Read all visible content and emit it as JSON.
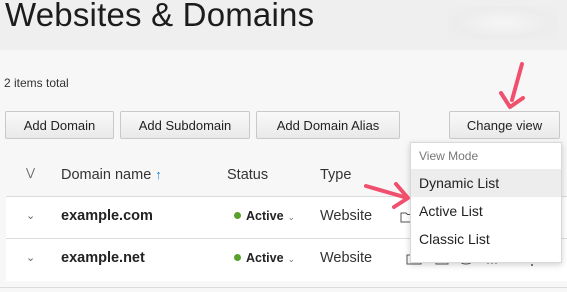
{
  "page": {
    "title": "Websites & Domains",
    "items_total": "2 items total"
  },
  "toolbar": {
    "add_domain": "Add Domain",
    "add_subdomain": "Add Subdomain",
    "add_domain_alias": "Add Domain Alias",
    "change_view": "Change view"
  },
  "table": {
    "columns": {
      "domain_name": "Domain name",
      "status": "Status",
      "type": "Type"
    },
    "sort_icon": "arrow-up-icon",
    "rows": [
      {
        "domain": "example.com",
        "status": "Active",
        "type": "Website"
      },
      {
        "domain": "example.net",
        "status": "Active",
        "type": "Website"
      }
    ]
  },
  "view_menu": {
    "header": "View Mode",
    "options": [
      "Dynamic List",
      "Active List",
      "Classic List"
    ],
    "highlighted": "Dynamic List"
  },
  "colors": {
    "annotation_arrow": "#f0506e",
    "status_active": "#5aa02c",
    "sort_arrow": "#2a7fd4"
  }
}
